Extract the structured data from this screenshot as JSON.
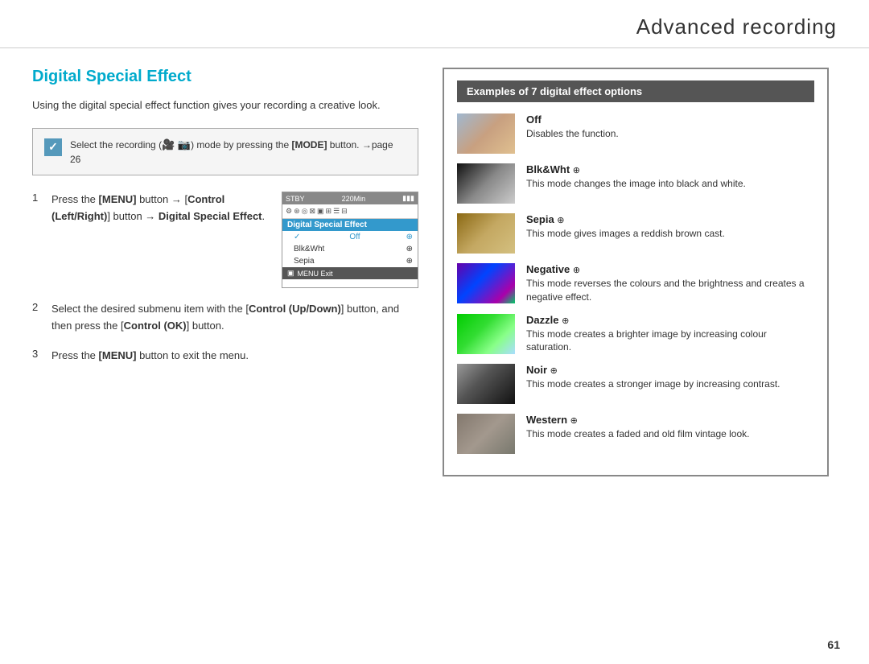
{
  "header": {
    "title": "Advanced recording"
  },
  "left": {
    "section_title": "Digital Special Effect",
    "intro": "Using the digital special effect function gives your recording a creative look.",
    "note": {
      "text": "Select the recording (",
      "mode_text": ") mode by pressing the ",
      "mode_bold": "[MODE]",
      "suffix": " button. →page 26"
    },
    "steps": [
      {
        "number": "1",
        "parts": [
          {
            "text": "Press the ",
            "bold": false
          },
          {
            "text": "[MENU]",
            "bold": true
          },
          {
            "text": " button → [",
            "bold": false
          },
          {
            "text": "Control (Left/Right)",
            "bold": true
          },
          {
            "text": "] button → ",
            "bold": false
          },
          {
            "text": "Digital Special Effect",
            "bold": true
          },
          {
            "text": ".",
            "bold": false
          }
        ]
      },
      {
        "number": "2",
        "parts": [
          {
            "text": "Select the desired submenu item with the [",
            "bold": false
          },
          {
            "text": "Control (Up/Down)",
            "bold": true
          },
          {
            "text": "] button, and then press the [",
            "bold": false
          },
          {
            "text": "Control (OK)",
            "bold": true
          },
          {
            "text": "] button.",
            "bold": false
          }
        ]
      },
      {
        "number": "3",
        "parts": [
          {
            "text": "Press the ",
            "bold": false
          },
          {
            "text": "[MENU]",
            "bold": true
          },
          {
            "text": " button to exit the menu.",
            "bold": false
          }
        ]
      }
    ],
    "camera_ui": {
      "top_left": "STBY",
      "top_right": "220Min",
      "menu_header": "Digital Special Effect",
      "menu_items": [
        {
          "label": "Off",
          "selected": true
        },
        {
          "label": "Blk&Wht",
          "selected": false
        },
        {
          "label": "Sepia",
          "selected": false
        }
      ],
      "bottom": "MENU Exit"
    }
  },
  "right": {
    "examples_header": "Examples of 7 digital effect options",
    "effects": [
      {
        "title": "Off",
        "icon": "",
        "desc": "Disables the function.",
        "thumb_class": "thumb-off"
      },
      {
        "title": "Blk&Wht",
        "icon": "⊕",
        "desc": "This mode changes the image into black and white.",
        "thumb_class": "thumb-bw"
      },
      {
        "title": "Sepia",
        "icon": "⊕",
        "desc": "This mode gives images a reddish brown cast.",
        "thumb_class": "thumb-sepia"
      },
      {
        "title": "Negative",
        "icon": "⊕",
        "desc": "This mode reverses the colours and the brightness and creates a negative effect.",
        "thumb_class": "thumb-negative"
      },
      {
        "title": "Dazzle",
        "icon": "⊕",
        "desc": "This mode creates a brighter image by increasing colour saturation.",
        "thumb_class": "thumb-dazzle"
      },
      {
        "title": "Noir",
        "icon": "⊕",
        "desc": "This mode creates a stronger image by increasing contrast.",
        "thumb_class": "thumb-noir"
      },
      {
        "title": "Western",
        "icon": "⊕",
        "desc": "This mode creates a faded and old film vintage look.",
        "thumb_class": "thumb-western"
      }
    ]
  },
  "page_number": "61"
}
